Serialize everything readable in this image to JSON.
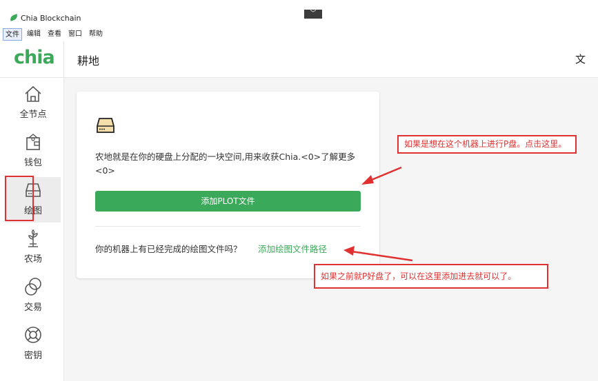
{
  "app": {
    "title": "Chia Blockchain",
    "collapse_glyph": "﹀"
  },
  "menu": [
    "文件",
    "编辑",
    "查看",
    "窗口",
    "帮助"
  ],
  "header": {
    "logo": "chia",
    "title": "耕地",
    "right_fragment": "文"
  },
  "sidebar": {
    "items": [
      {
        "label": "全节点",
        "icon": "home-icon"
      },
      {
        "label": "钱包",
        "icon": "wallet-icon"
      },
      {
        "label": "绘图",
        "icon": "hard-drive-icon",
        "active": true
      },
      {
        "label": "农场",
        "icon": "plant-icon"
      },
      {
        "label": "交易",
        "icon": "trade-icon"
      },
      {
        "label": "密钥",
        "icon": "keys-icon"
      }
    ]
  },
  "card": {
    "description": "农地就是在你的硬盘上分配的一块空间,用来收获Chia.<0>了解更多<0>",
    "add_plot_button": "添加PLOT文件",
    "existing_question": "你的机器上有已经完成的绘图文件吗？",
    "add_path_link": "添加绘图文件路径"
  },
  "annotations": {
    "callout_plot": "如果是想在这个机器上进行P盘。点击这里。",
    "callout_path": "如果之前就P好盘了，可以在这里添加进去就可以了。"
  },
  "colors": {
    "brand_green": "#3aaa5a",
    "annotation_red": "#e03030"
  }
}
